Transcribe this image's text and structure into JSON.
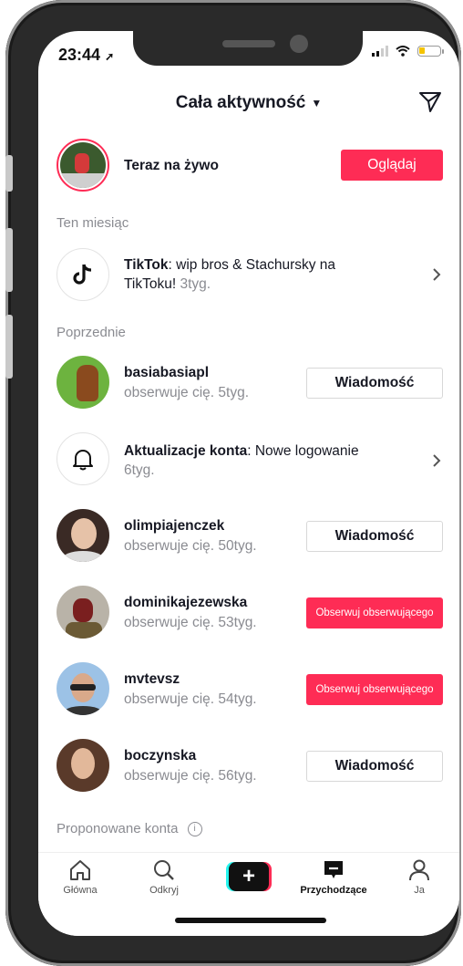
{
  "status": {
    "time": "23:44"
  },
  "header": {
    "title": "Cała aktywność"
  },
  "live": {
    "label": "Teraz na żywo",
    "button": "Oglądaj"
  },
  "sections": {
    "this_month": "Ten miesiąc",
    "previous": "Poprzednie",
    "suggested": "Proponowane konta"
  },
  "tiktok_notice": {
    "sender": "TikTok",
    "text": ": wip bros & Stachursky na",
    "text2": "TikToku! ",
    "time": "3tyg."
  },
  "account_update": {
    "title": "Aktualizacje konta",
    "text": ": Nowe logowanie",
    "time": "6tyg."
  },
  "activity": [
    {
      "name": "basiabasiapl",
      "text": "obserwuje cię. ",
      "time": "5tyg.",
      "button": "Wiadomość",
      "button_type": "message",
      "avatar_color": "#6db33f"
    },
    {
      "name": "olimpiajenczek",
      "text": "obserwuje cię. ",
      "time": "50tyg.",
      "button": "Wiadomość",
      "button_type": "message",
      "avatar_color": "#3a2a25"
    },
    {
      "name": "dominikajezewska",
      "text": "obserwuje cię. ",
      "time": "53tyg.",
      "button": "Obserwuj obserwującego",
      "button_type": "follow",
      "avatar_color": "#7a5a3a"
    },
    {
      "name": "mvtevsz",
      "text": "obserwuje cię. ",
      "time": "54tyg.",
      "button": "Obserwuj obserwującego",
      "button_type": "follow",
      "avatar_color": "#6a9ac8"
    },
    {
      "name": "boczynska",
      "text": "obserwuje cię. ",
      "time": "56tyg.",
      "button": "Wiadomość",
      "button_type": "message",
      "avatar_color": "#5a3a2a"
    }
  ],
  "tabs": [
    {
      "label": "Główna",
      "icon": "home-icon"
    },
    {
      "label": "Odkryj",
      "icon": "search-icon"
    },
    {
      "label": "",
      "icon": "create-plus-icon"
    },
    {
      "label": "Przychodzące",
      "icon": "inbox-icon"
    },
    {
      "label": "Ja",
      "icon": "profile-icon"
    }
  ],
  "colors": {
    "accent": "#fe2c55",
    "text": "#161823",
    "secondary": "#8a8b91"
  }
}
